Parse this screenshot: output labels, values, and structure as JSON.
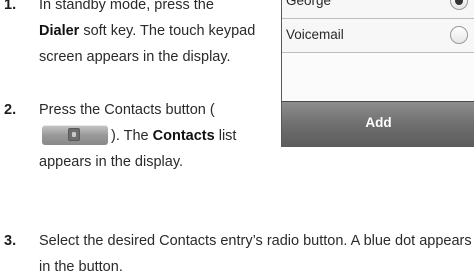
{
  "steps": [
    {
      "number": "1.",
      "text_1": "In standby mode, press the",
      "bold_1": "Dialer",
      "text_2": " soft key. The touch keypad screen appears in the display."
    },
    {
      "number": "2.",
      "text_1": "Press the Contacts button (",
      "text_2": "). The ",
      "bold_1": "Contacts",
      "text_3": " list appears in the display."
    },
    {
      "number": "3.",
      "text_1": "Select the desired Contacts entry’s radio button. A blue dot appears in the button."
    }
  ],
  "phone": {
    "contacts": [
      {
        "name": "George",
        "selected": true
      },
      {
        "name": "Voicemail",
        "selected": false
      }
    ],
    "add_label": "Add"
  },
  "icons": {
    "contacts_button_icon": "contacts-book-icon"
  }
}
